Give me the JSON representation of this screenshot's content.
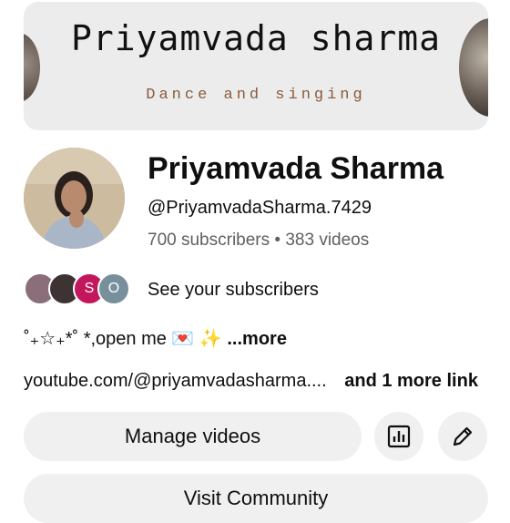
{
  "banner": {
    "title": "Priyamvada sharma",
    "subtitle": "Dance and singing"
  },
  "channel": {
    "name": "Priyamvada Sharma",
    "handle": "@PriyamvadaSharma.7429",
    "subscribers": "700 subscribers",
    "separator": "•",
    "videos": "383 videos"
  },
  "subscribers_preview": {
    "avatars": [
      {
        "kind": "photo",
        "color": "#8a6f7a"
      },
      {
        "kind": "photo",
        "color": "#3d3333"
      },
      {
        "kind": "letter",
        "letter": "S",
        "color": "#c2185b"
      },
      {
        "kind": "letter",
        "letter": "O",
        "color": "#78909c"
      }
    ],
    "label": "See your subscribers"
  },
  "description": {
    "text": "˚₊☆₊*˚ *,open me 💌 ✨",
    "more": "...more"
  },
  "links": {
    "url": "youtube.com/@priyamvadasharma....",
    "more": "and 1 more link"
  },
  "actions": {
    "manage_videos": "Manage videos",
    "analytics_icon": "analytics-icon",
    "edit_icon": "pencil-icon",
    "visit_community": "Visit Community"
  }
}
